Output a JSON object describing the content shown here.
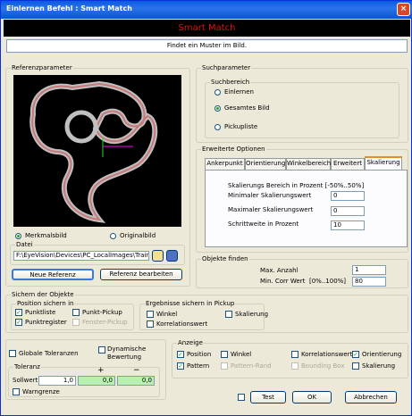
{
  "window": {
    "title": "Einlernen Befehl : Smart Match",
    "close": "×"
  },
  "banner": "Smart Match",
  "description": "Findet ein Muster im Bild.",
  "ref": {
    "group": "Referenzparameter",
    "radio_merkmal": "Merkmalsbild",
    "radio_original": "Originalbild",
    "file_group": "Datei",
    "file_path": "F:\\EyeVision\\Devices\\PC_LocalImages\\Trainig",
    "btn_new": "Neue Referenz",
    "btn_edit": "Referenz bearbeiten"
  },
  "search": {
    "group": "Suchparameter",
    "area_group": "Suchbereich",
    "opt1": "Einlernen",
    "opt2": "Gesamtes Bild",
    "opt3": "Pickupliste"
  },
  "ext": {
    "group": "Erweiterte Optionen",
    "tabs": [
      "Ankerpunkt",
      "Orientierung",
      "Winkelbereich",
      "Erweitert",
      "Skalierung"
    ],
    "range_label": "Skalierungs Bereich in Prozent [-50%..50%]",
    "min_label": "Minimaler Skalierungswert",
    "min_val": "0",
    "max_label": "Maximaler Skalierungswert",
    "max_val": "0",
    "step_label": "Schrittweite in Prozent",
    "step_val": "10"
  },
  "objects": {
    "group": "Objekte finden",
    "max_label": "Max. Anzahl",
    "max_val": "1",
    "min_label": "Min. Corr Wert",
    "min_range": "[0%..100%]",
    "min_val": "80"
  },
  "secure": {
    "group": "Sichern der Objekte",
    "pos_group": "Position sichern in",
    "punktliste": "Punktliste",
    "punkt_pickup": "Punkt-Pickup",
    "punktregister": "Punktregister",
    "fenster_pickup": "Fenster-Pickup",
    "res_group": "Ergebnisse sichern in Pickup",
    "winkel": "Winkel",
    "skalierung": "Skalierung",
    "korr": "Korrelationswert"
  },
  "tol": {
    "global": "Globale Toleranzen",
    "dyn": "Dynamische Bewertung",
    "group": "Toleranz",
    "plus": "+",
    "minus": "−",
    "soll_label": "Sollwert",
    "soll": "1,0",
    "plus_val": "0,0",
    "minus_val": "0,0",
    "warn": "Warngrenze"
  },
  "display": {
    "group": "Anzeige",
    "position": "Position",
    "winkel": "Winkel",
    "korr": "Korrelationswert",
    "orient": "Orientierung",
    "pattern": "Pattern",
    "pattern_rand": "Pattern-Rand",
    "bbox": "Bounding Box",
    "skal": "Skalierung"
  },
  "buttons": {
    "test": "Test",
    "ok": "OK",
    "cancel": "Abbrechen"
  }
}
